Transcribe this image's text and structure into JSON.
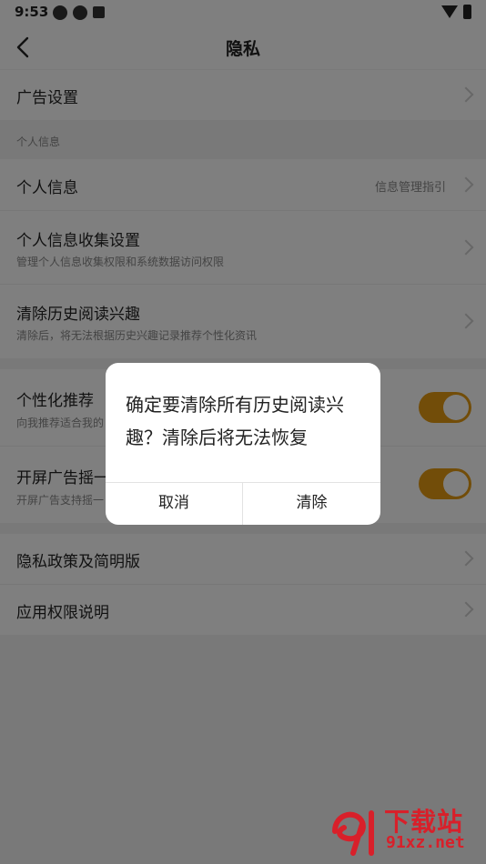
{
  "status_bar": {
    "time": "9:53"
  },
  "nav": {
    "title": "隐私"
  },
  "rows": {
    "ad_settings": {
      "title": "广告设置"
    },
    "section_personal": {
      "label": "个人信息"
    },
    "personal_info": {
      "title": "个人信息",
      "right": "信息管理指引"
    },
    "collection_settings": {
      "title": "个人信息收集设置",
      "subtitle": "管理个人信息收集权限和系统数据访问权限"
    },
    "clear_history": {
      "title": "清除历史阅读兴趣",
      "subtitle": "清除后，将无法根据历史兴趣记录推荐个性化资讯"
    },
    "personalized": {
      "title": "个性化推荐",
      "subtitle": "向我推荐适合我的",
      "on": true
    },
    "splash_shake": {
      "title": "开屏广告摇一",
      "subtitle": "开屏广告支持摇一",
      "on": true
    },
    "privacy_policy": {
      "title": "隐私政策及简明版"
    },
    "permissions": {
      "title": "应用权限说明"
    }
  },
  "dialog": {
    "message": "确定要清除所有历史阅读兴趣？清除后将无法恢复",
    "cancel_label": "取消",
    "confirm_label": "清除"
  },
  "watermark": {
    "brand": "下载站",
    "url": "91xz.net"
  },
  "colors": {
    "accent": "#e59a12",
    "watermark": "#d8202a"
  }
}
